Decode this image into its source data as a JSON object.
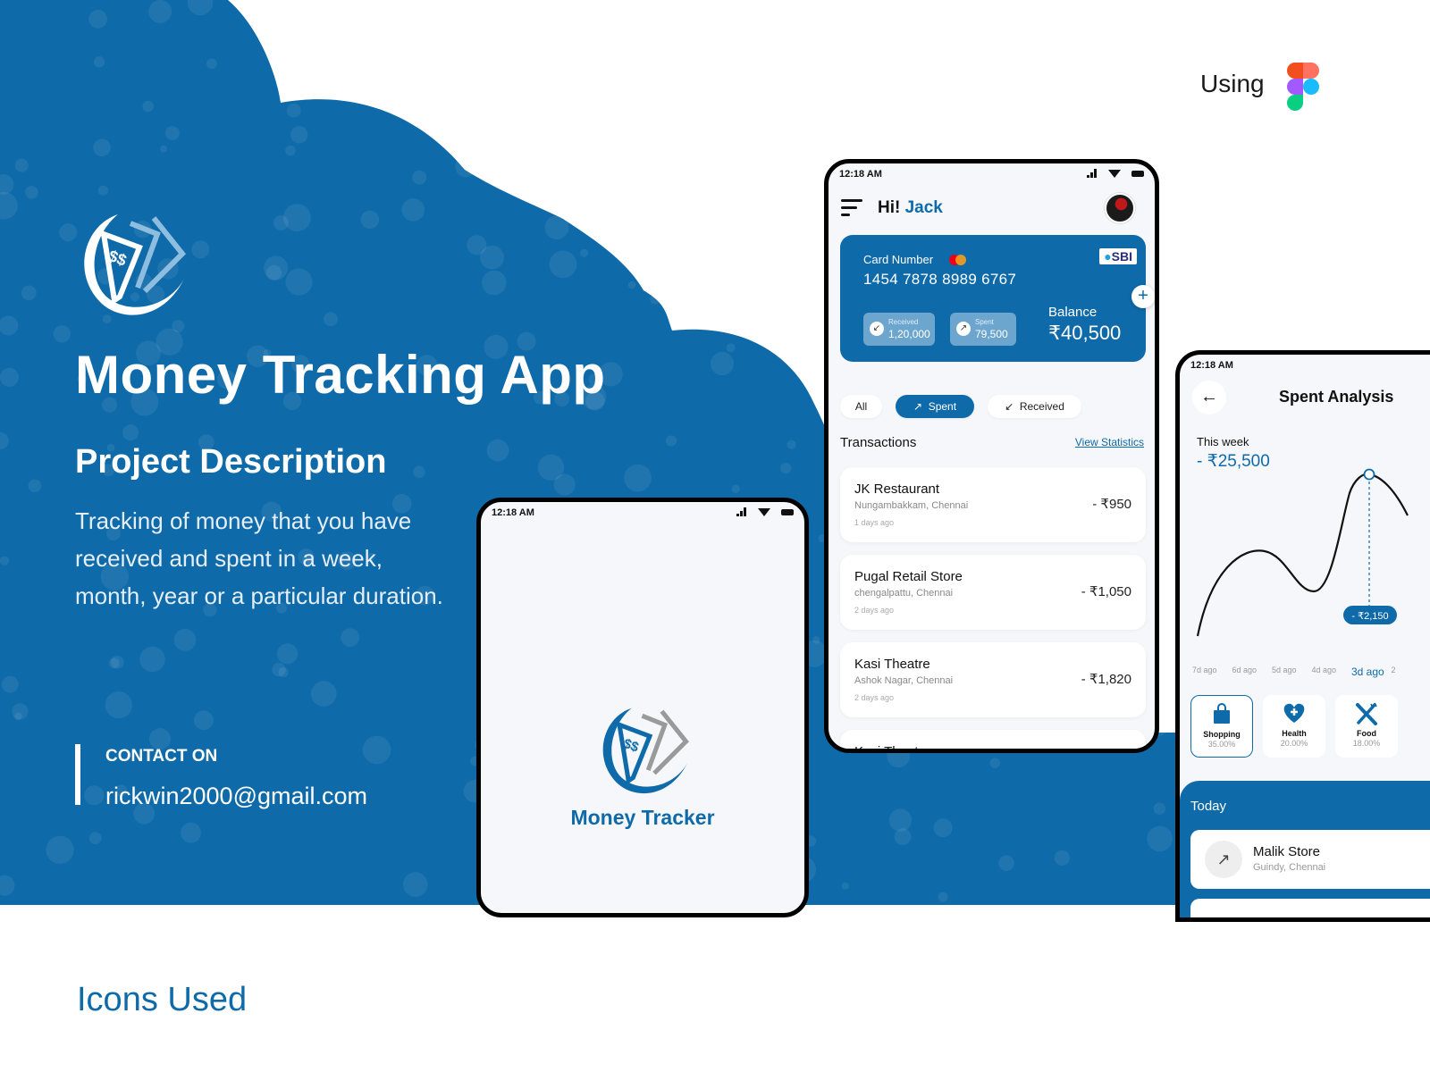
{
  "colors": {
    "brand_blue": "#0e6aa9",
    "background": "#ffffff",
    "screen_bg": "#f5f7fa"
  },
  "hero": {
    "logo_icon": "money-tracker-logo-icon",
    "title": "Money Tracking App",
    "description_heading": "Project Description",
    "description": "Tracking of money that you have received and spent in a week, month, year or a particular duration.",
    "contact_label": "CONTACT ON",
    "contact_email": "rickwin2000@gmail.com"
  },
  "tools": {
    "label": "Using",
    "tool_icon": "figma-icon"
  },
  "status_bar": {
    "time": "12:18 AM"
  },
  "splash_screen": {
    "app_name": "Money Tracker"
  },
  "home_screen": {
    "greeting": "Hi!",
    "user_name": "Jack",
    "card": {
      "label": "Card Number",
      "number": "1454 7878 8989 6767",
      "bank": "SBI",
      "received_label": "Received",
      "received_value": "1,20,000",
      "spent_label": "Spent",
      "spent_value": "79,500",
      "balance_label": "Balance",
      "balance_value": "₹40,500"
    },
    "filters": [
      {
        "label": "All",
        "icon": "",
        "active": false
      },
      {
        "label": "Spent",
        "icon": "↗",
        "active": true
      },
      {
        "label": "Received",
        "icon": "↙",
        "active": false
      }
    ],
    "transactions_heading": "Transactions",
    "view_statistics": "View Statistics",
    "transactions": [
      {
        "name": "JK Restaurant",
        "location": "Nungambakkam, Chennai",
        "time": "1 days ago",
        "amount": "- ₹950"
      },
      {
        "name": "Pugal Retail Store",
        "location": "chengalpattu, Chennai",
        "time": "2 days ago",
        "amount": "- ₹1,050"
      },
      {
        "name": "Kasi Theatre",
        "location": "Ashok Nagar, Chennai",
        "time": "2 days ago",
        "amount": "- ₹1,820"
      },
      {
        "name": "Kasi Theatre",
        "location": "",
        "time": "",
        "amount": ""
      }
    ]
  },
  "analysis_screen": {
    "title": "Spent Analysis",
    "period_label": "This week",
    "period_total": "- ₹25,500",
    "tooltip_value": "- ₹2,150",
    "x_labels": [
      "7d ago",
      "6d ago",
      "5d ago",
      "4d ago",
      "3d ago",
      "2"
    ],
    "selected_label": "3d ago",
    "categories": [
      {
        "name": "Shopping",
        "percent": "35.00%",
        "icon": "shopping-bag-icon",
        "glyph": "🛍",
        "active": true
      },
      {
        "name": "Health",
        "percent": "20.00%",
        "icon": "heart-plus-icon",
        "glyph": "♥",
        "active": false
      },
      {
        "name": "Food",
        "percent": "18.00%",
        "icon": "fork-knife-icon",
        "glyph": "✕",
        "active": false
      }
    ],
    "today_label": "Today",
    "today_transactions": [
      {
        "name": "Malik Store",
        "location": "Guindy, Chennai"
      }
    ]
  },
  "footer": {
    "icons_used_heading": "Icons Used"
  }
}
